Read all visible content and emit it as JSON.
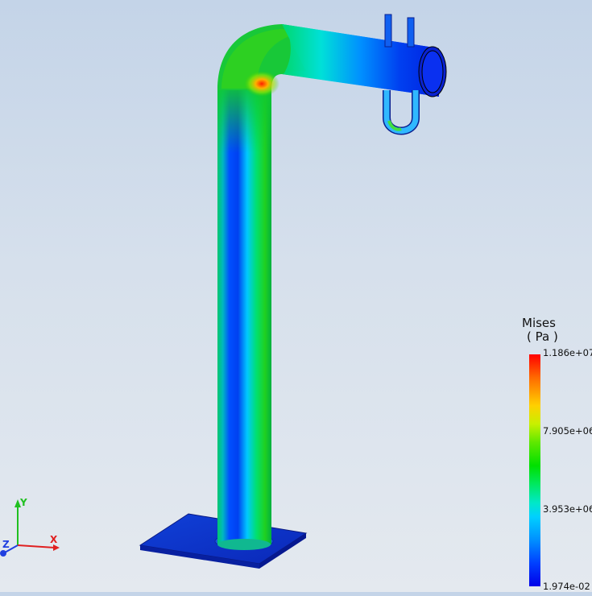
{
  "legend": {
    "title": "Mises",
    "unit": "( Pa )",
    "ticks": [
      "1.186e+07",
      "7.905e+06",
      "3.953e+06",
      "1.974e-02"
    ]
  },
  "triad": {
    "x": "X",
    "y": "Y",
    "z": "Z"
  },
  "colors": {
    "max": "#ff0000",
    "min": "#0000e8",
    "axis_x": "#e02020",
    "axis_y": "#20c020",
    "axis_z": "#2040e0"
  }
}
